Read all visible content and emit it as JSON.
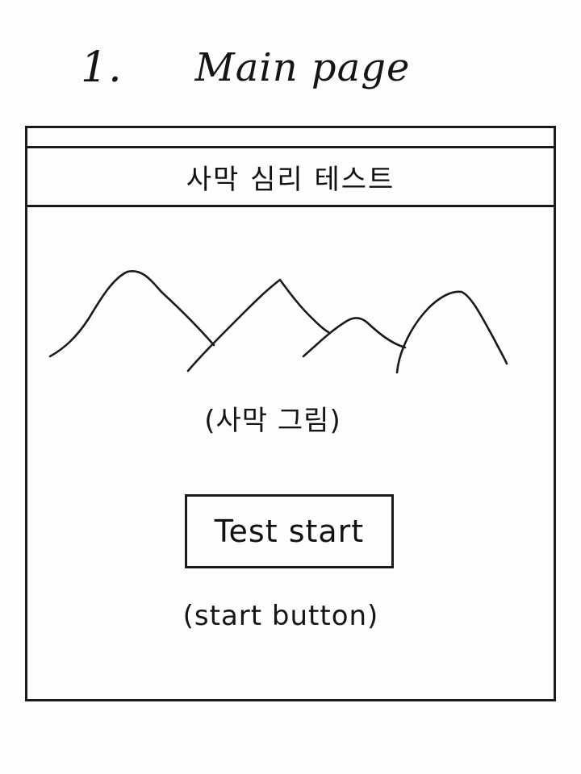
{
  "sheet": {
    "number": "1.",
    "title": "Main page"
  },
  "app": {
    "title": "사막 심리 테스트"
  },
  "illustration": {
    "icon": "desert-mountains-icon",
    "caption": "(사막 그림)"
  },
  "start": {
    "button_label": "Test start",
    "caption": "(start button)"
  }
}
